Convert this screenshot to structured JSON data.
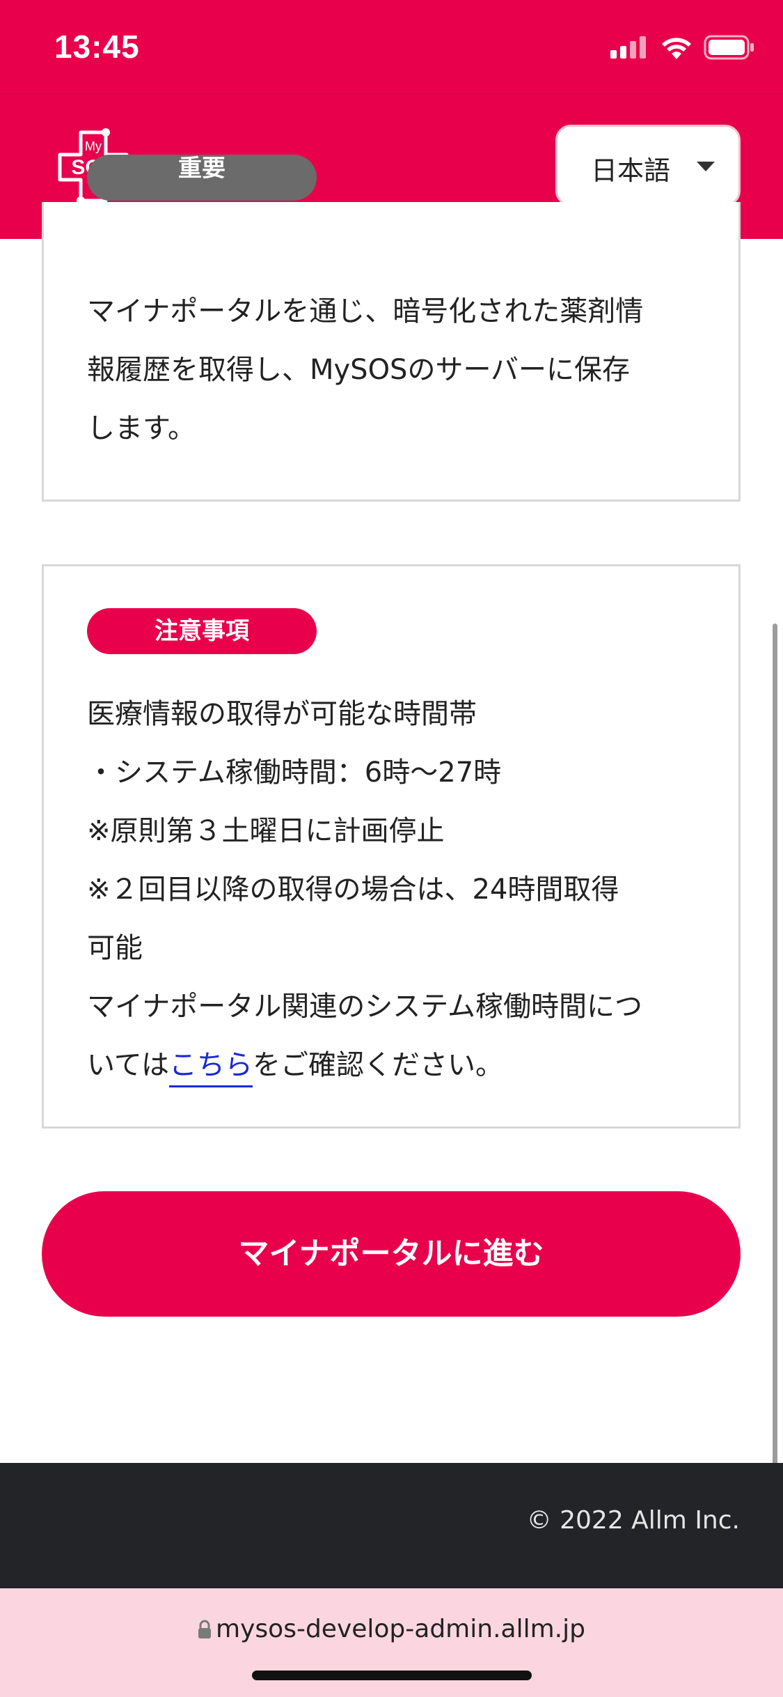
{
  "status_bar": {
    "time": "13:45"
  },
  "header": {
    "logo_text": "My SOS",
    "language": {
      "selected": "日本語"
    }
  },
  "important_card": {
    "badge": "重要",
    "lines": [
      "マイナポータルを通じ、暗号化された薬剤情",
      "報履歴を取得し、MySOSのサーバーに保存",
      "します。"
    ]
  },
  "notes_card": {
    "badge": "注意事項",
    "lines": [
      "医療情報の取得が可能な時間帯",
      "・システム稼働時間：6時〜27時",
      "※原則第３土曜日に計画停止",
      "※２回目以降の取得の場合は、24時間取得",
      "可能",
      "マイナポータル関連のシステム稼働時間につ"
    ],
    "last_line_prefix": "いては",
    "link_text": "こちら",
    "last_line_suffix": "をご確認ください。"
  },
  "cta": {
    "label": "マイナポータルに進む"
  },
  "footer": {
    "copyright": "© 2022 Allm Inc."
  },
  "browser": {
    "url": "mysos-develop-admin.allm.jp"
  },
  "colors": {
    "brand": "#e9004c",
    "footer": "#232427",
    "url_bar": "#fbd6e1",
    "link": "#1a2ad8"
  }
}
